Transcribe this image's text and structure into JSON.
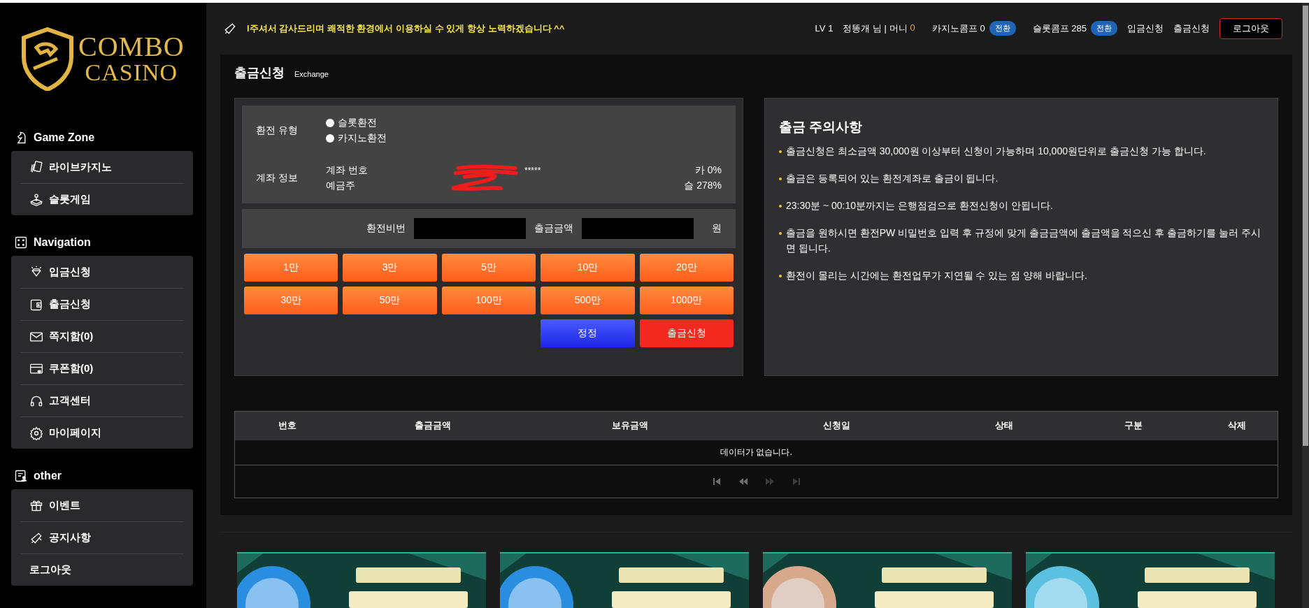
{
  "logo": {
    "line1": "COMBO",
    "line2": "CASINO"
  },
  "sidebar": {
    "sections": [
      {
        "kind": "game",
        "title": "Game Zone",
        "items": [
          {
            "kind": "cards",
            "label": "라이브카지노"
          },
          {
            "kind": "joystick",
            "label": "슬롯게임"
          }
        ]
      },
      {
        "kind": "dice",
        "title": "Navigation",
        "items": [
          {
            "kind": "diamond",
            "label": "입금신청"
          },
          {
            "kind": "wallet",
            "label": "출금신청"
          },
          {
            "kind": "mail",
            "label": "쪽지함(0)"
          },
          {
            "kind": "coupon",
            "label": "쿠폰함(0)"
          },
          {
            "kind": "headset",
            "label": "고객센터"
          },
          {
            "kind": "gear",
            "label": "마이페이지"
          }
        ]
      },
      {
        "kind": "doc",
        "title": "other",
        "items": [
          {
            "kind": "gift",
            "label": "이벤트"
          },
          {
            "kind": "megaphone",
            "label": "공지사항"
          },
          {
            "kind": "none",
            "label": "로그아웃"
          }
        ]
      }
    ]
  },
  "header": {
    "notice": "l주셔서 감사드리며 쾌적한 환경에서 이용하실 수 있게 항상 노력하겠습니다 ^^",
    "level": "LV 1",
    "user": "정똥개 님 | 머니",
    "money": "0",
    "comps": [
      {
        "label": "카지노콤프 0",
        "button": "전환"
      },
      {
        "label": "슬롯콤프 285",
        "button": "전환"
      }
    ],
    "links": [
      "입금신청",
      "출금신청"
    ],
    "logout": "로그아웃"
  },
  "page": {
    "title": "출금신청",
    "subtitle": "Exchange"
  },
  "form": {
    "type_label": "환전 유형",
    "options": [
      {
        "label": "슬롯환전",
        "selected": false
      },
      {
        "label": "카지노환전",
        "selected": false
      }
    ],
    "account_label": "계좌 정보",
    "account_number_label": "계좌 번호",
    "account_number": "*****",
    "holder_label": "예금주",
    "rate_1": "카 0%",
    "rate_2": "슬 278%",
    "password_label": "환전비번",
    "amount_label": "출금금액",
    "unit": "원",
    "amounts": [
      "1만",
      "3만",
      "5만",
      "10만",
      "20만",
      "30만",
      "50만",
      "100만",
      "500만",
      "1000만"
    ],
    "actions": [
      {
        "kind": "reset",
        "label": "정정"
      },
      {
        "kind": "submit",
        "label": "출금신청"
      }
    ]
  },
  "notice": {
    "title": "출금 주의사항",
    "items": [
      "출금신청은 최소금액 30,000원 이상부터 신청이 가능하며 10,000원단위로 출금신청 가능 합니다.",
      "출금은 등록되어 있는 환전계좌로 출금이 됩니다.",
      "23:30분 ~ 00:10분까지는 은행점검으로 환전신청이 안됩니다.",
      "출금을 원하시면 환전PW 비밀번호 입력 후 규정에 맞게 출금금액에 출금액을 적으신 후 출금하기를 눌러 주시면 됩니다.",
      "환전이 몰리는 시간에는 환전업무가 지연될 수 있는 점 양해 바랍니다."
    ]
  },
  "table": {
    "columns": [
      "번호",
      "출금금액",
      "보유금액",
      "신청일",
      "상태",
      "구분",
      "삭제"
    ],
    "empty": "데이터가 없습니다.",
    "pagination": [
      {
        "kind": "first",
        "disabled": false
      },
      {
        "kind": "prev",
        "disabled": false
      },
      {
        "kind": "next",
        "disabled": true
      },
      {
        "kind": "last",
        "disabled": true
      }
    ]
  }
}
